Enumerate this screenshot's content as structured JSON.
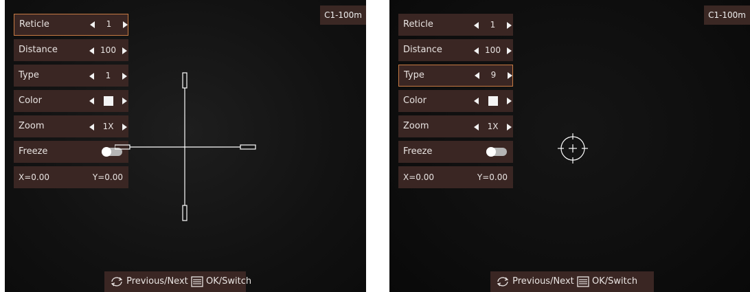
{
  "panels": [
    {
      "badge": "C1-100m",
      "menu": {
        "reticle_label": "Reticle",
        "reticle_value": "1",
        "distance_label": "Distance",
        "distance_value": "100",
        "type_label": "Type",
        "type_value": "1",
        "color_label": "Color",
        "color_value": "white",
        "zoom_label": "Zoom",
        "zoom_value": "1X",
        "freeze_label": "Freeze",
        "freeze_on": false,
        "x": "X=0.00",
        "y": "Y=0.00",
        "selected_item": "Reticle"
      },
      "hint": {
        "prev_next": "Previous/Next",
        "ok_switch": "OK/Switch"
      },
      "reticle_style": "duplex-crosshair"
    },
    {
      "badge": "C1-100m",
      "menu": {
        "reticle_label": "Reticle",
        "reticle_value": "1",
        "distance_label": "Distance",
        "distance_value": "100",
        "type_label": "Type",
        "type_value": "9",
        "color_label": "Color",
        "color_value": "white",
        "zoom_label": "Zoom",
        "zoom_value": "1X",
        "freeze_label": "Freeze",
        "freeze_on": false,
        "x": "X=0.00",
        "y": "Y=0.00",
        "selected_item": "Type"
      },
      "hint": {
        "prev_next": "Previous/Next",
        "ok_switch": "OK/Switch"
      },
      "reticle_style": "circle-crosshair"
    }
  ],
  "colors": {
    "menu_bg": "#3a2623",
    "selected_border": "#c77a43",
    "reticle": "#ffffff"
  },
  "icons": {
    "prev_next": "rotate-arrows-icon",
    "ok_switch": "menu-list-icon",
    "arrow_left": "triangle-left-icon",
    "arrow_right": "triangle-right-icon"
  }
}
